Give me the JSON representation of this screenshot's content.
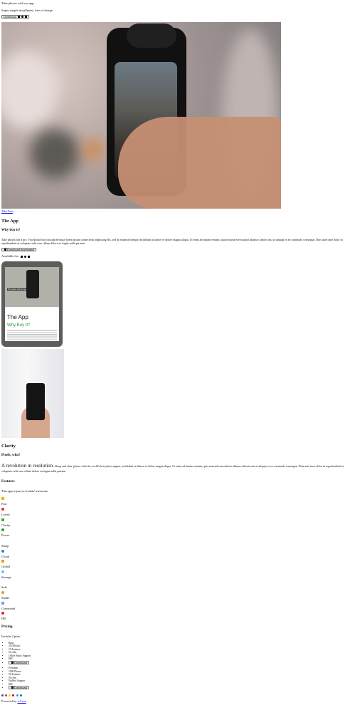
{
  "header": {
    "tagline": "Take photos with our app",
    "subline": "Super simple installment, free of charge",
    "download_label": "Download"
  },
  "hero": {
    "take_tour": "Take Tour"
  },
  "app": {
    "title": "The App",
    "subtitle": "Why buy it?",
    "body": "Take photos like a pro. You should buy this app because lorem ipsum consectetur adipiscing elit, sed do eiusmod tempor incididunt ut labore et dolore magna aliqua. Ut enim ad minim veniam, quis nostrud exercitation ullamco laboris nisi ut aliquip ex ea commodo consequat. Duis aute irure dolor in reprehenderit in voluptate velit esse cillum dolore eu fugiat nulla pariatur.",
    "download_label": "Download Application",
    "available_for": "Available for:"
  },
  "tablet": {
    "app_label": "The App",
    "why_label": "Why Buy It?",
    "image_label": "Take photos with our app"
  },
  "clarity": {
    "title": "Clarity",
    "subtitle": "Pixels, who?",
    "lead": "A revolution in resolution.",
    "body": "Sharp and clear photos with the world's best photo engine, incididunt ut labore et dolore magna aliqua. Ut enim ad minim veniam, quis nostrud exercitation ullamco laboris nisi ut aliquip ex ea commodo consequat. Duis aute irure dolor in reprehenderit in voluptate velit esse cillum dolore eu fugiat nulla pariatur."
  },
  "features": {
    "title": "Features",
    "intro": "This app is just so freakin' awesome",
    "items": [
      {
        "label": "Fast",
        "icon": "bolt-icon",
        "color": "#f2b400"
      },
      {
        "label": "Loved",
        "icon": "heart-icon",
        "color": "#e03030"
      },
      {
        "label": "Clarity",
        "icon": "star-icon",
        "color": "#4aaa2a"
      },
      {
        "label": "Power",
        "icon": "battery-icon",
        "color": "#2a9d43"
      },
      {
        "label": "Sharp",
        "icon": "gem-icon",
        "color": "#ffffff"
      },
      {
        "label": "Cloud",
        "icon": "cloud-icon",
        "color": "#2f7fd6"
      },
      {
        "label": "Global",
        "icon": "globe-icon",
        "color": "#e0a020"
      },
      {
        "label": "Storage",
        "icon": "storage-icon",
        "color": "#67c7e6"
      },
      {
        "label": "Safe",
        "icon": "shield-icon",
        "color": "#ffffff"
      },
      {
        "label": "Stable",
        "icon": "stable-icon",
        "color": "#e0a020"
      },
      {
        "label": "Connected",
        "icon": "wifi-icon",
        "color": "#7aa0c8"
      },
      {
        "label": "HD",
        "icon": "hd-icon",
        "color": "#d62a2a"
      }
    ]
  },
  "pricing": {
    "title": "Pricing",
    "intro": "Include 2 plan",
    "plans": [
      {
        "features": [
          "Basic",
          "250 Photos",
          "10 Features",
          "No Ads",
          "Office Hours Support",
          "$80"
        ],
        "button": "Download"
      },
      {
        "features": [
          "Premium",
          "1000 Photos",
          "50 Features",
          "No Ads",
          "Endless Support",
          "$99"
        ],
        "button": "Download"
      }
    ]
  },
  "footer": {
    "powered_by": "Powered by",
    "link": "w3.css",
    "social_icons": [
      "facebook-icon",
      "instagram-icon",
      "snapchat-icon",
      "pinterest-icon",
      "twitter-icon",
      "linkedin-icon"
    ]
  }
}
